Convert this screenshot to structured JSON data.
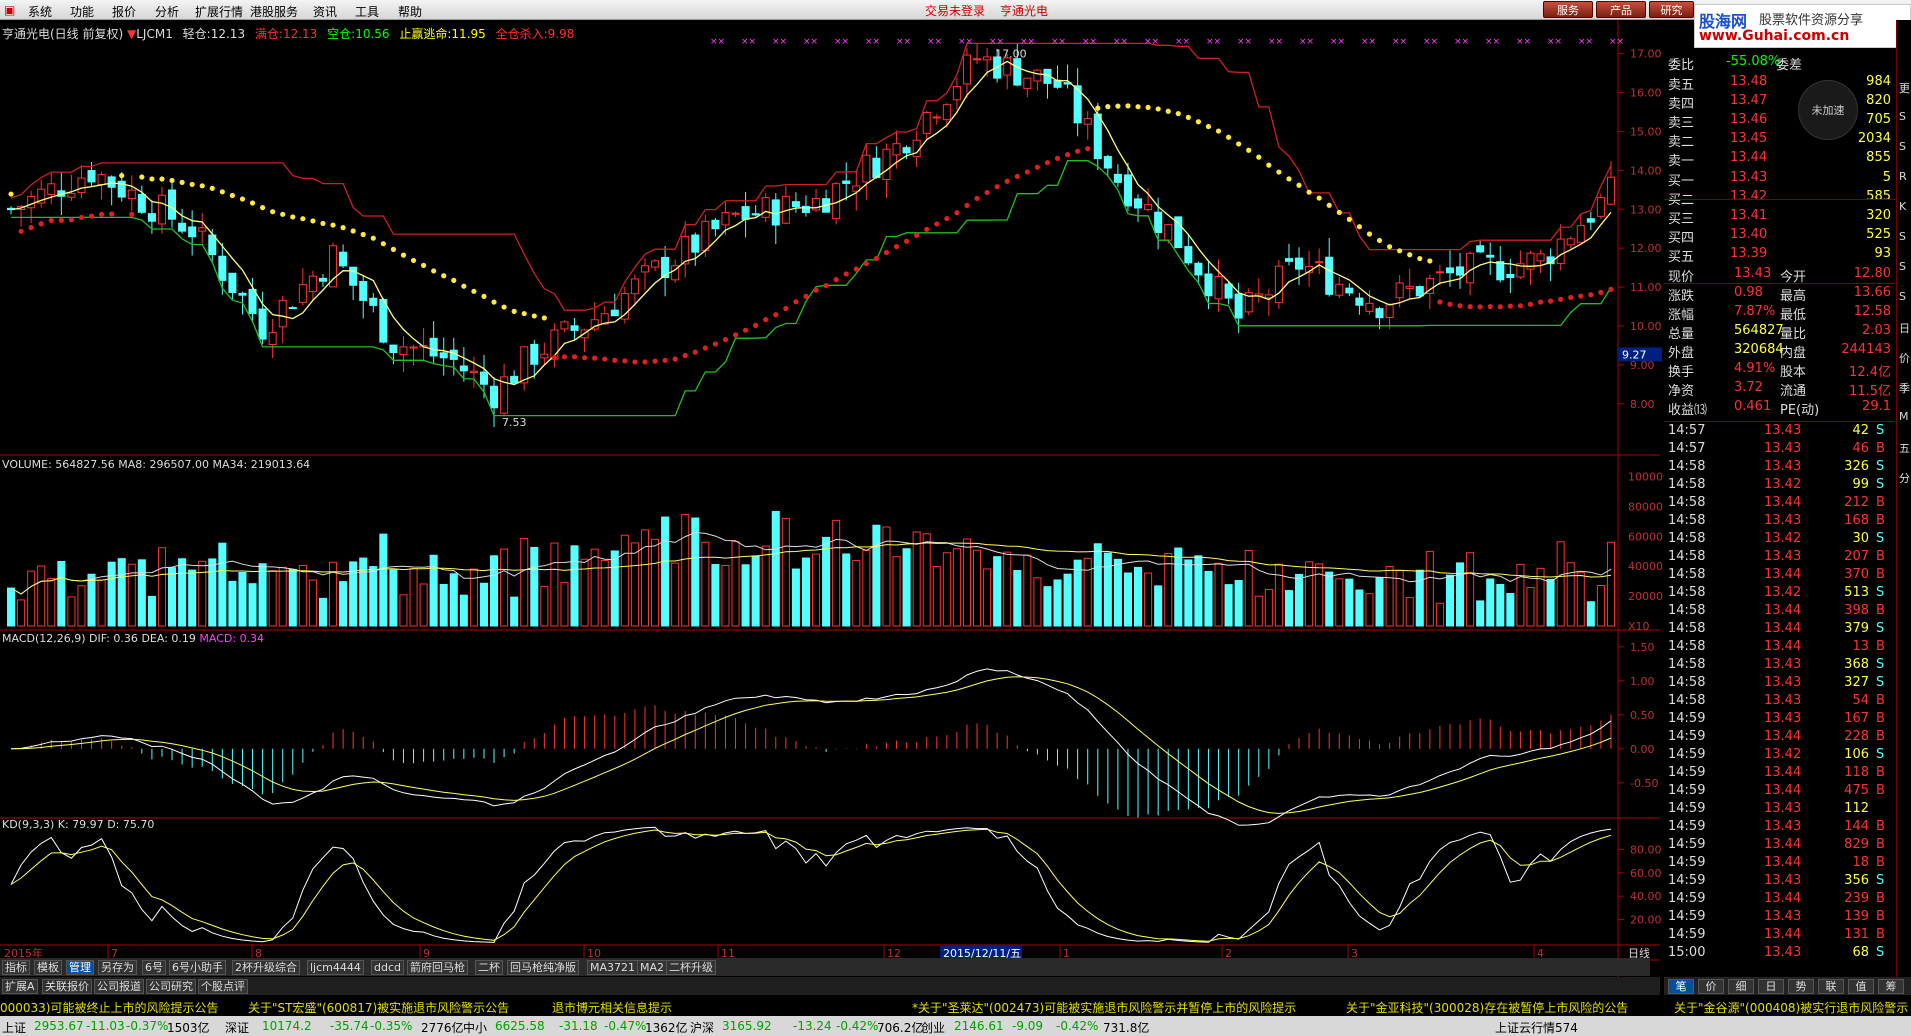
{
  "menu": [
    "系统",
    "功能",
    "报价",
    "分析",
    "扩展行情",
    "港股服务",
    "资讯",
    "工具",
    "帮助"
  ],
  "center_status": "交易未登录",
  "stock_title": "亨通光电",
  "top_buttons": [
    "服务",
    "产品",
    "研究"
  ],
  "logo": {
    "l1": "股海网",
    "l1b": "股票软件资源分享",
    "l2": "www.Guhai.com.cn"
  },
  "header": {
    "name": "亨通光电(日线 前复权)",
    "indicator": "LJCM1",
    "light_label": "轻仓:",
    "light_val": "12.13",
    "heavy_label": "满仓:",
    "heavy_val": "12.13",
    "empty_label": "空仓:",
    "empty_val": "10.56",
    "stop_label": "止赢逃命:",
    "stop_val": "11.95",
    "full_label": "全仓杀入:",
    "full_val": "9.98"
  },
  "price_axis": [
    "17.00",
    "16.00",
    "15.00",
    "14.00",
    "13.00",
    "12.00",
    "11.00",
    "10.00",
    "9.00",
    "8.00"
  ],
  "price_hl": [
    "17.00",
    "7.53"
  ],
  "cur_price_tag": "9.27",
  "volume_header": {
    "label": "VOLUME:",
    "val": "564827.56",
    "ma8": "MA8: 296507.00",
    "ma34": "MA34: 219013.64"
  },
  "volume_axis": [
    "100000",
    "80000",
    "60000",
    "40000",
    "20000",
    "X10"
  ],
  "macd_header": {
    "label": "MACD(12,26,9)",
    "dif": "DIF: 0.36",
    "dea": "DEA: 0.19",
    "macd": "MACD: 0.34"
  },
  "macd_axis": [
    "1.50",
    "1.00",
    "0.50",
    "0.00",
    "-0.50"
  ],
  "kd_header": {
    "label": "KD(9,3,3)",
    "k": "K: 79.97",
    "d": "D: 75.70"
  },
  "kd_axis": [
    "80.00",
    "60.00",
    "40.00",
    "20.00"
  ],
  "date_axis": {
    "year": "2015年",
    "labels": [
      "7",
      "8",
      "9",
      "10",
      "11",
      "12",
      "1",
      "2",
      "3",
      "4"
    ],
    "cursor": "2015/12/11/五",
    "period": "日线"
  },
  "order_book": {
    "wb_label": "委比",
    "wb_val": "-55.08%",
    "wc_label": "委差",
    "asks": [
      {
        "l": "卖五",
        "p": "13.48",
        "v": "984"
      },
      {
        "l": "卖四",
        "p": "13.47",
        "v": "820"
      },
      {
        "l": "卖三",
        "p": "13.46",
        "v": "705"
      },
      {
        "l": "卖二",
        "p": "13.45",
        "v": "2034"
      },
      {
        "l": "卖一",
        "p": "13.44",
        "v": "855"
      }
    ],
    "bids": [
      {
        "l": "买一",
        "p": "13.43",
        "v": "5"
      },
      {
        "l": "买二",
        "p": "13.42",
        "v": "585"
      },
      {
        "l": "买三",
        "p": "13.41",
        "v": "320"
      },
      {
        "l": "买四",
        "p": "13.40",
        "v": "525"
      },
      {
        "l": "买五",
        "p": "13.39",
        "v": "93"
      }
    ],
    "badge": "未加速"
  },
  "stats": [
    {
      "a": "现价",
      "b": "13.43",
      "c": "今开",
      "d": "12.80"
    },
    {
      "a": "涨跌",
      "b": "0.98",
      "c": "最高",
      "d": "13.66"
    },
    {
      "a": "涨幅",
      "b": "7.87%",
      "c": "最低",
      "d": "12.58"
    },
    {
      "a": "总量",
      "b": "564827",
      "c": "量比",
      "d": "2.03"
    },
    {
      "a": "外盘",
      "b": "320684",
      "c": "内盘",
      "d": "244143"
    },
    {
      "a": "换手",
      "b": "4.91%",
      "c": "股本",
      "d": "12.4亿"
    },
    {
      "a": "净资",
      "b": "3.72",
      "c": "流通",
      "d": "11.5亿"
    },
    {
      "a": "收益⒀",
      "b": "0.461",
      "c": "PE(动)",
      "d": "29.1"
    }
  ],
  "ticks": [
    [
      "14:57",
      "13.43",
      "42",
      "S"
    ],
    [
      "14:57",
      "13.43",
      "46",
      "B"
    ],
    [
      "14:58",
      "13.43",
      "326",
      "S"
    ],
    [
      "14:58",
      "13.42",
      "99",
      "S"
    ],
    [
      "14:58",
      "13.44",
      "212",
      "B"
    ],
    [
      "14:58",
      "13.43",
      "168",
      "B"
    ],
    [
      "14:58",
      "13.42",
      "30",
      "S"
    ],
    [
      "14:58",
      "13.43",
      "207",
      "B"
    ],
    [
      "14:58",
      "13.44",
      "370",
      "B"
    ],
    [
      "14:58",
      "13.42",
      "513",
      "S"
    ],
    [
      "14:58",
      "13.44",
      "398",
      "B"
    ],
    [
      "14:58",
      "13.44",
      "379",
      "S"
    ],
    [
      "14:58",
      "13.44",
      "13",
      "B"
    ],
    [
      "14:58",
      "13.43",
      "368",
      "S"
    ],
    [
      "14:58",
      "13.43",
      "327",
      "S"
    ],
    [
      "14:58",
      "13.43",
      "54",
      "B"
    ],
    [
      "14:59",
      "13.43",
      "167",
      "B"
    ],
    [
      "14:59",
      "13.44",
      "228",
      "B"
    ],
    [
      "14:59",
      "13.42",
      "106",
      "S"
    ],
    [
      "14:59",
      "13.44",
      "118",
      "B"
    ],
    [
      "14:59",
      "13.44",
      "475",
      "B"
    ],
    [
      "14:59",
      "13.43",
      "112",
      ""
    ],
    [
      "14:59",
      "13.43",
      "144",
      "B"
    ],
    [
      "14:59",
      "13.44",
      "829",
      "B"
    ],
    [
      "14:59",
      "13.44",
      "18",
      "B"
    ],
    [
      "14:59",
      "13.43",
      "356",
      "S"
    ],
    [
      "14:59",
      "13.44",
      "239",
      "B"
    ],
    [
      "14:59",
      "13.43",
      "139",
      "B"
    ],
    [
      "14:59",
      "13.44",
      "131",
      "B"
    ],
    [
      "15:00",
      "13.43",
      "68",
      "S"
    ]
  ],
  "tabs1": [
    "指标",
    "模板",
    "管理",
    "另存为",
    "6号",
    "6号小助手",
    "2杯升级综合",
    "ljcm4444",
    "ddcd",
    "箭府回马枪",
    "二杯",
    "回马枪纯净版",
    "MA3721",
    "MA2",
    "二杯升级"
  ],
  "tabs2": [
    "扩展A",
    "关联报价",
    "公司报道",
    "公司研究",
    "个股点评"
  ],
  "rtabs": [
    "笔",
    "价",
    "细",
    "日",
    "势",
    "联",
    "值",
    "筹"
  ],
  "ticker": [
    "000033)可能被终止上市的风险提示公告",
    "关于\"ST宏盛\"(600817)被实施退市风险警示公告",
    "退市博元相关信息提示",
    "*关于\"圣莱达\"(002473)可能被实施退市风险警示并暂停上市的风险提示",
    "关于\"金亚科技\"(300028)存在被暂停上市风险的公告",
    "关于\"金谷源\"(000408)被实行退市风险警示"
  ],
  "status": [
    "上证",
    "2953.67",
    "-11.03",
    "-0.37%",
    "1503亿",
    "深证",
    "10174.2",
    "-35.74",
    "-0.35%",
    "2776亿",
    "中小",
    "6625.58",
    "-31.18",
    "-0.47%",
    "1362亿",
    "沪深",
    "3165.92",
    "-13.24",
    "-0.42%",
    "706.2亿",
    "创业",
    "2146.61",
    "-9.09",
    "-0.42%",
    "731.8亿",
    "上证云行情574"
  ],
  "right_strip": [
    "更",
    "S",
    "S",
    "R",
    "K",
    "S",
    "S",
    "S",
    "日",
    "价",
    "季",
    "M",
    "五",
    "分"
  ],
  "colors": {
    "up": "#ff3232",
    "down": "#54ffff",
    "yellow": "#ffff00",
    "green": "#00ff00",
    "axis": "#b00000"
  }
}
